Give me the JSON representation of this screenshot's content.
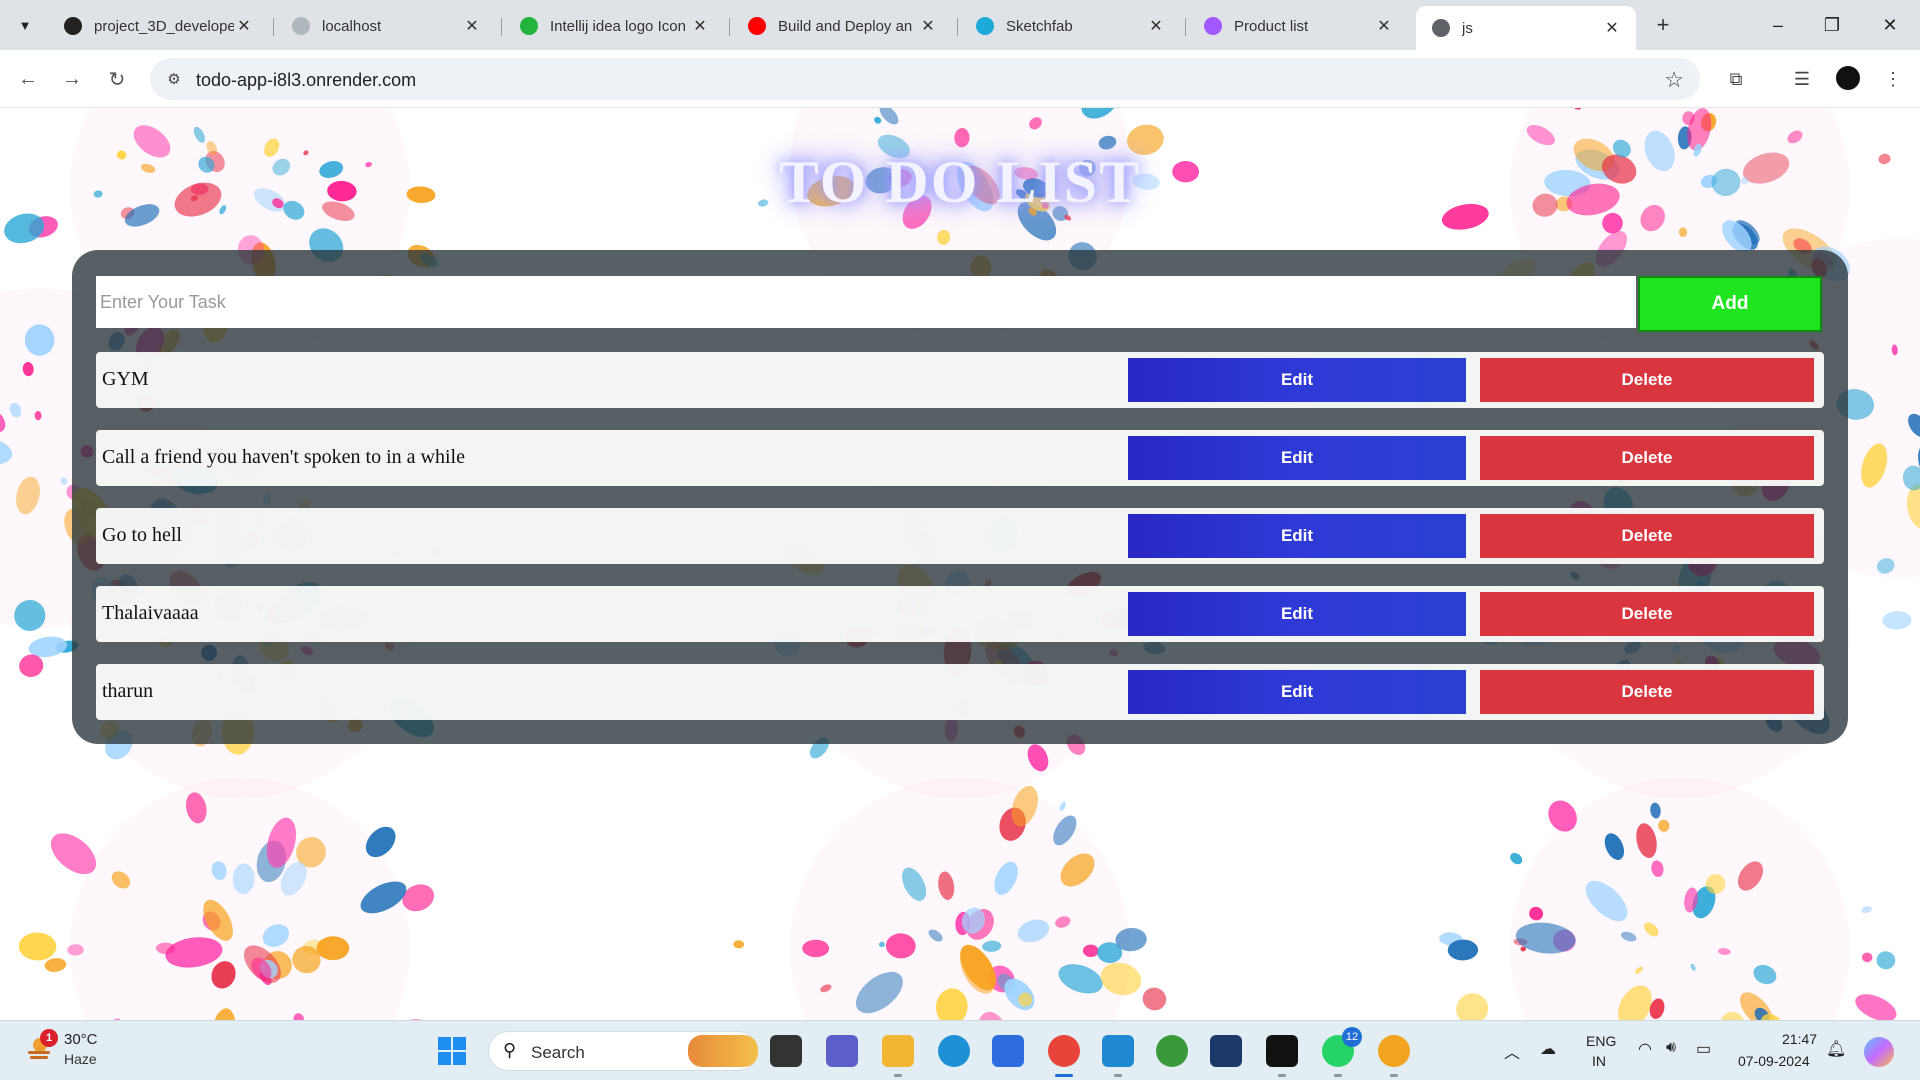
{
  "browser": {
    "tabs": [
      {
        "title": "project_3D_develope",
        "favicon": "github-icon",
        "color": "#222222"
      },
      {
        "title": "localhost",
        "favicon": "cloud-icon",
        "color": "#b0b7bd"
      },
      {
        "title": "Intellij idea logo Icon",
        "favicon": "intellij-icon",
        "color": "#22b43c"
      },
      {
        "title": "Build and Deploy an",
        "favicon": "youtube-icon",
        "color": "#ff0000"
      },
      {
        "title": "Sketchfab",
        "favicon": "sketchfab-icon",
        "color": "#1caad9"
      },
      {
        "title": "Product list",
        "favicon": "vite-icon",
        "color": "#a259ff"
      },
      {
        "title": "js",
        "favicon": "globe-icon",
        "color": "#5f6368"
      }
    ],
    "active_tab_index": 6,
    "new_tab_label": "+",
    "url": "todo-app-i8l3.onrender.com"
  },
  "app": {
    "heading": "TO DO LIST",
    "input_placeholder": "Enter Your Task",
    "input_value": "",
    "add_label": "Add",
    "tasks": [
      {
        "text": "GYM",
        "edit_label": "Edit",
        "delete_label": "Delete"
      },
      {
        "text": "Call a friend you haven't spoken to in a while",
        "edit_label": "Edit",
        "delete_label": "Delete"
      },
      {
        "text": "Go to hell",
        "edit_label": "Edit",
        "delete_label": "Delete"
      },
      {
        "text": "Thalaivaaaa",
        "edit_label": "Edit",
        "delete_label": "Delete"
      },
      {
        "text": "tharun",
        "edit_label": "Edit",
        "delete_label": "Delete"
      }
    ],
    "colors": {
      "add": "#1fe51f",
      "edit": "#2a36d0",
      "delete": "#d8353f",
      "panel": "#28343a"
    }
  },
  "taskbar": {
    "weather": {
      "temp": "30°C",
      "condition": "Haze",
      "badge": "1"
    },
    "search_label": "Search",
    "apps": [
      {
        "name": "widgets-icon",
        "color": "#e8903a"
      },
      {
        "name": "task-view-icon",
        "color": "#333333"
      },
      {
        "name": "teams-icon",
        "color": "#5b5fc7"
      },
      {
        "name": "file-explorer-icon",
        "color": "#f2b632"
      },
      {
        "name": "edge-icon",
        "color": "#1e90d6"
      },
      {
        "name": "store-icon",
        "color": "#2d6cdf"
      },
      {
        "name": "chrome-icon",
        "color": "#e9443a"
      },
      {
        "name": "vscode-icon",
        "color": "#1f8ad2"
      },
      {
        "name": "mongodb-compass-icon",
        "color": "#3a9a3a"
      },
      {
        "name": "pycharm-icon",
        "color": "#1b3a6b"
      },
      {
        "name": "intellij-icon",
        "color": "#111111"
      },
      {
        "name": "whatsapp-icon",
        "color": "#25d366"
      },
      {
        "name": "chrome-canary-icon",
        "color": "#f2a31f"
      }
    ],
    "whatsapp_badge": "12",
    "lang_line1": "ENG",
    "lang_line2": "IN",
    "time": "21:47",
    "date": "07-09-2024"
  }
}
